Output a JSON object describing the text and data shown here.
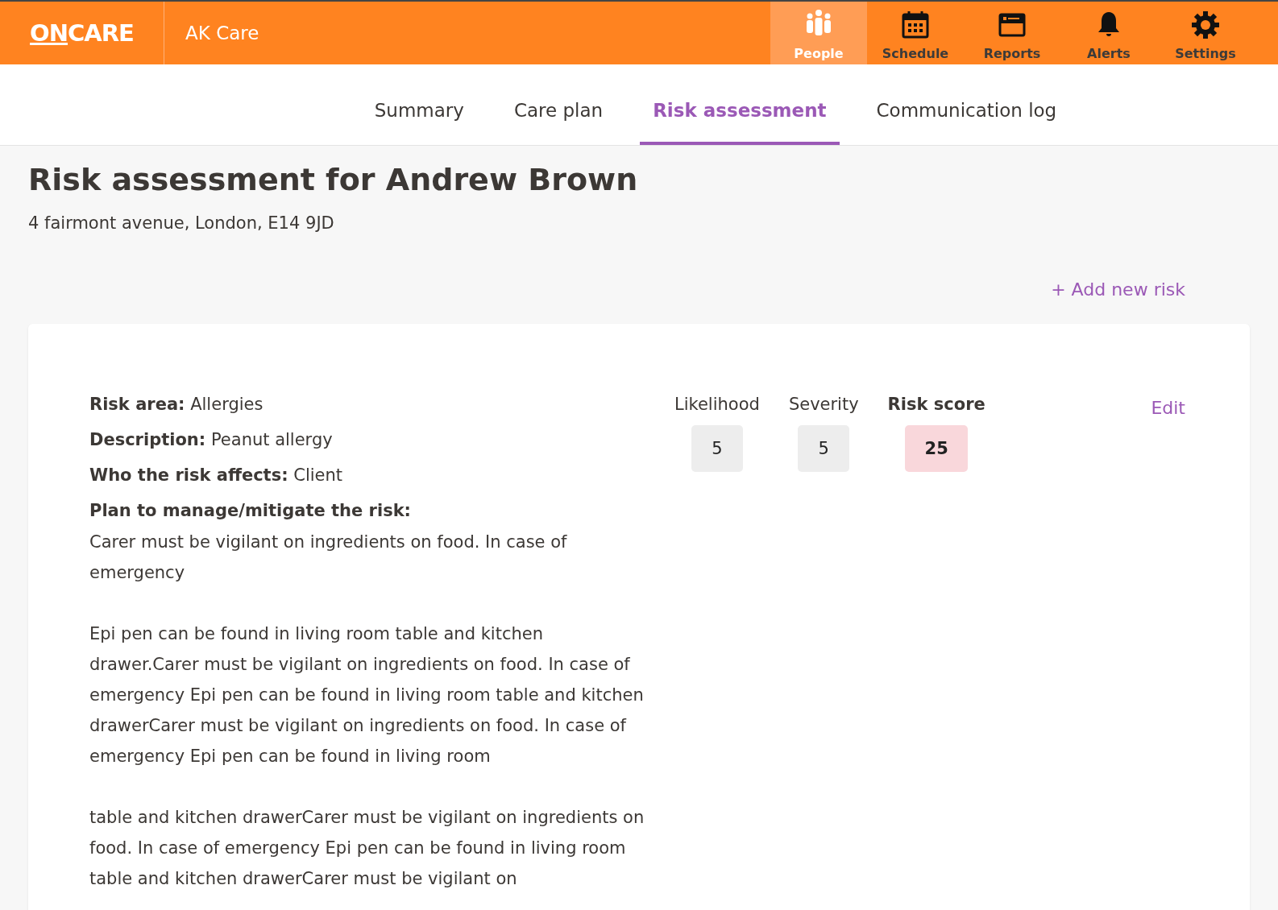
{
  "header": {
    "logo": {
      "underlined": "ON",
      "rest": "CARE"
    },
    "org": "AK Care",
    "nav": [
      {
        "label": "People",
        "selected": true
      },
      {
        "label": "Schedule",
        "selected": false
      },
      {
        "label": "Reports",
        "selected": false
      },
      {
        "label": "Alerts",
        "selected": false
      },
      {
        "label": "Settings",
        "selected": false
      }
    ]
  },
  "tabs": [
    {
      "label": "Summary",
      "selected": false
    },
    {
      "label": "Care plan",
      "selected": false
    },
    {
      "label": "Risk assessment",
      "selected": true
    },
    {
      "label": "Communication log",
      "selected": false
    }
  ],
  "title": "Risk assessment for Andrew Brown",
  "address": "4 fairmont avenue, London, E14 9JD",
  "add_link": "+ Add new risk",
  "risk": {
    "fields": [
      {
        "label": "Risk area:",
        "value": "Allergies"
      },
      {
        "label": "Description:",
        "value": "Peanut allergy"
      },
      {
        "label": "Who the risk affects:",
        "value": "Client"
      }
    ],
    "plan_label": "Plan to manage/mitigate the risk:",
    "plan": [
      "Carer must be vigilant on ingredients on food. In case of emergency",
      "Epi pen can be found in living room table and kitchen drawer.Carer must be vigilant on ingredients on food. In case of emergency Epi pen can be found in living room table and kitchen drawerCarer must be vigilant on ingredients on food. In case of emergency Epi pen can be found in living room",
      "table and kitchen drawerCarer must be vigilant on ingredients on food. In case of emergency Epi pen can be found in living room table and kitchen drawerCarer must be vigilant on"
    ],
    "scores": [
      {
        "label": "Likelihood",
        "value": "5",
        "kind": "plain"
      },
      {
        "label": "Severity",
        "value": "5",
        "kind": "plain"
      },
      {
        "label": "Risk score",
        "value": "25",
        "kind": "total"
      }
    ],
    "edit": "Edit"
  }
}
